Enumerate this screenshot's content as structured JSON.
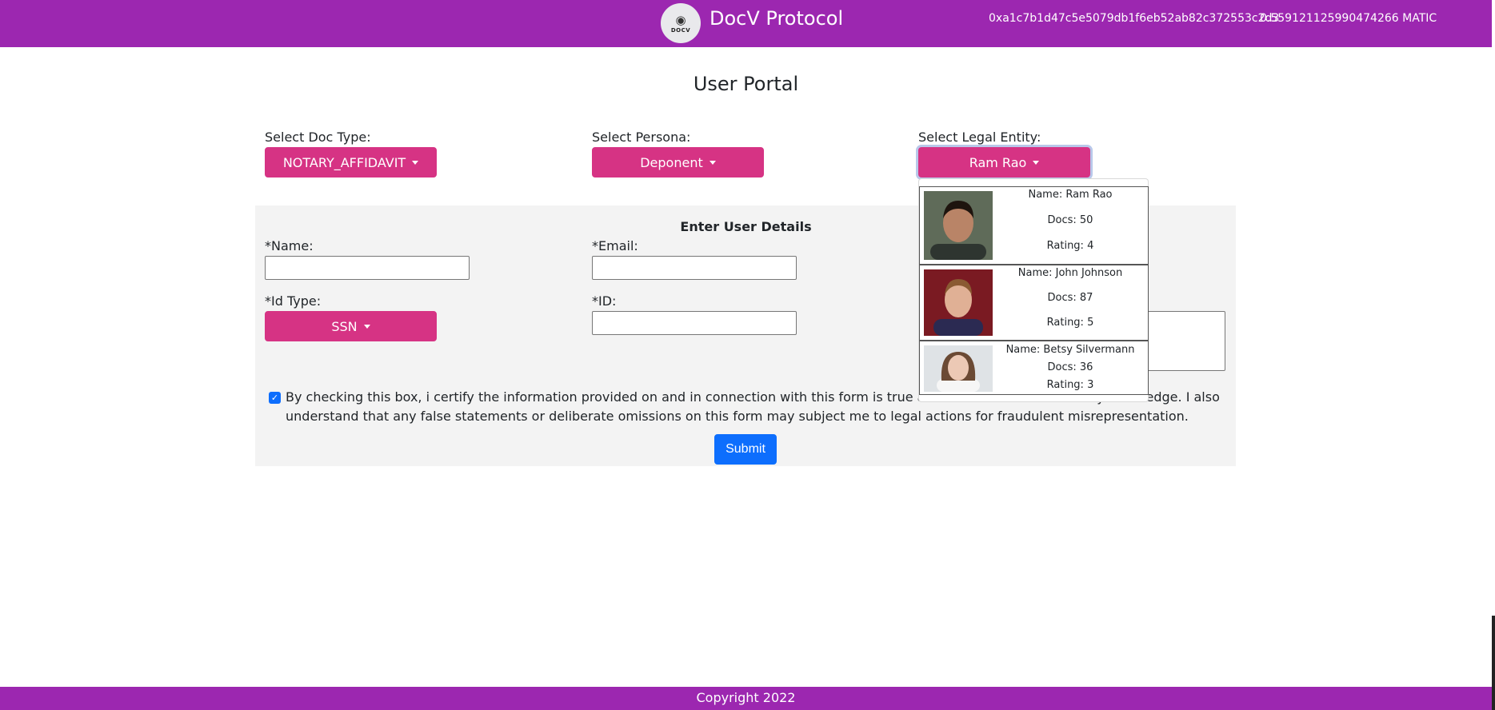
{
  "header": {
    "logo_text": "DOCV",
    "brand": "DocV Protocol",
    "wallet_address": "0xa1c7b1d47c5e5079db1f6eb52ab82c372553c2d3",
    "balance": "0.559121125990474266 MATIC"
  },
  "page_title": "User Portal",
  "selectors": {
    "doc_type": {
      "label": "Select Doc Type:",
      "value": "NOTARY_AFFIDAVIT"
    },
    "persona": {
      "label": "Select Persona:",
      "value": "Deponent"
    },
    "legal_entity": {
      "label": "Select Legal Entity:",
      "value": "Ram Rao"
    }
  },
  "form": {
    "title": "Enter User Details",
    "name_label": "*Name:",
    "email_label": "*Email:",
    "id_type_label": "*Id Type:",
    "id_type_value": "SSN",
    "id_label": "*ID:",
    "name_value": "",
    "email_value": "",
    "id_value": "",
    "consent_text": "By checking this box, i certify the information provided on and in connection with this form is true and correct to the best of my knowledge. I also understand that any false statements or deliberate omissions on this form may subject me to legal actions for fraudulent misrepresentation.",
    "consent_checked": true,
    "submit_label": "Submit"
  },
  "entity_menu": [
    {
      "name": "Name: Ram Rao",
      "docs": "Docs: 50",
      "rating": "Rating: 4",
      "skin": "#b98467",
      "hair": "#1e140e",
      "bg": "#5f6b59",
      "shirt": "#2e3530"
    },
    {
      "name": "Name: John Johnson",
      "docs": "Docs: 87",
      "rating": "Rating: 5",
      "skin": "#e0b095",
      "hair": "#8a5a32",
      "bg": "#7a1a22",
      "shirt": "#2b2a52"
    },
    {
      "name": "Name: Betsy Silvermann",
      "docs": "Docs: 36",
      "rating": "Rating: 3",
      "skin": "#ecc9b5",
      "hair": "#6b4a34",
      "bg": "#dfe3e6",
      "shirt": "#f6f6f6"
    }
  ],
  "footer": "Copyright 2022"
}
